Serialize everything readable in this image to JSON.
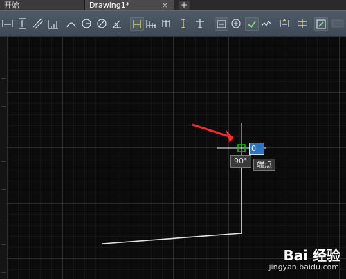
{
  "tabs": {
    "start_label": "开始",
    "drawing_label": "Drawing1*",
    "close_glyph": "×",
    "add_glyph": "+"
  },
  "toolbar": {
    "icons": [
      "horizontal-dimension-icon",
      "vertical-dimension-icon",
      "aligned-dimension-icon",
      "baseline-dimension-icon",
      "arc-dimension-icon",
      "radius-dimension-icon",
      "diameter-dimension-icon",
      "angular-dimension-icon",
      "quick-dimension-icon",
      "continue-dimension-icon",
      "dimension-space-icon",
      "dimension-break-icon",
      "tolerance-icon",
      "center-mark-icon",
      "inspection-icon",
      "jogged-linear-icon",
      "dimension-edit-icon",
      "dimension-text-edit-icon",
      "update-dimension-icon",
      "dimension-style-icon"
    ]
  },
  "canvas": {
    "angle_tooltip": "90°",
    "snap_label": "端点",
    "input_value": "0"
  },
  "watermark": {
    "line1": "Bai 经验",
    "line2": "jingyan.baidu.com"
  },
  "colors": {
    "canvas_bg": "#0b0b0b",
    "grid": "#5a5a5a",
    "line": "#e6e6e6",
    "arrow": "#ff2a2a",
    "snap": "#00c800",
    "input_bg": "#2d73c7"
  }
}
